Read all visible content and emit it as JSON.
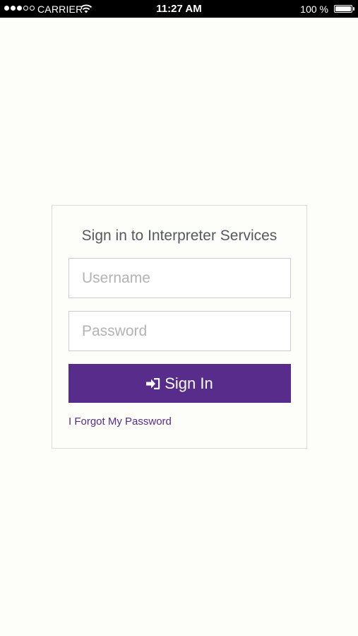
{
  "status_bar": {
    "signal_dots": [
      "full",
      "full",
      "full",
      "empty",
      "empty"
    ],
    "carrier": "CARRIER",
    "wifi_icon": "wifi-icon",
    "time": "11:27 AM",
    "battery_percent": "100 %",
    "battery_level": 1.0,
    "battery_icon": "battery-icon"
  },
  "login": {
    "title": "Sign in to Interpreter Services",
    "username": {
      "placeholder": "Username",
      "value": ""
    },
    "password": {
      "placeholder": "Password",
      "value": ""
    },
    "sign_in_button": {
      "icon": "sign-in-icon",
      "label": "Sign In"
    },
    "forgot_link": "I Forgot My Password"
  },
  "colors": {
    "accent": "#582c8b",
    "background": "#fdfdf9",
    "status_bar": "#000000",
    "title_text": "#555a5f",
    "placeholder_text": "#b3b3b3",
    "card_border": "#dcdcdc",
    "input_border": "#cccccc"
  }
}
